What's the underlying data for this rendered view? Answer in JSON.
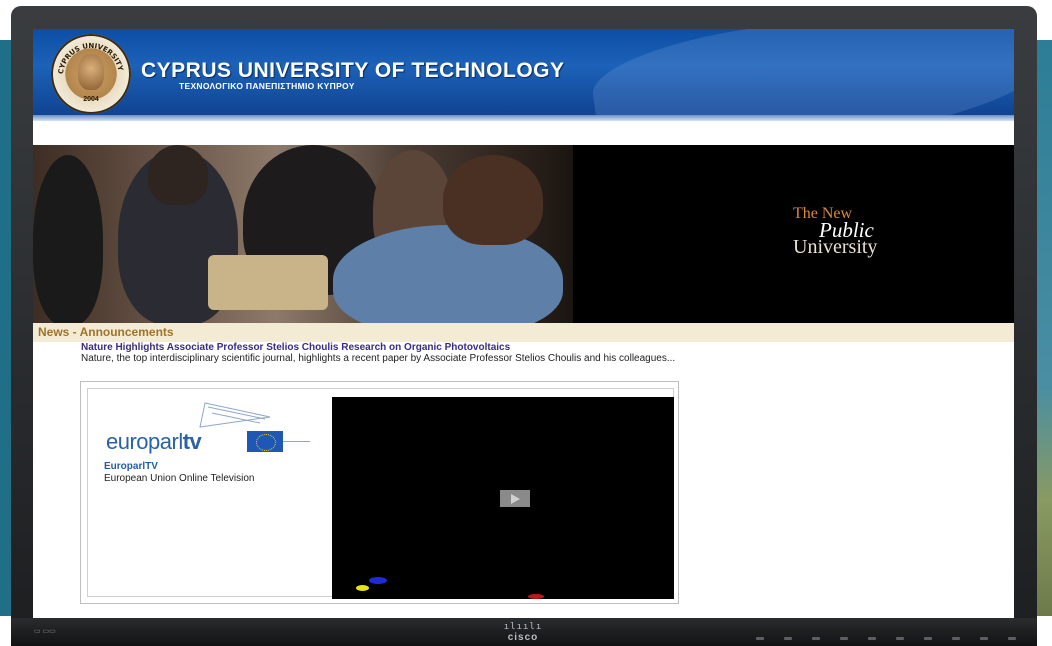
{
  "site": {
    "title": "CYPRUS UNIVERSITY OF TECHNOLOGY",
    "subtitle": "ΤΕΧΝΟΛΟΓΙΚΟ ΠΑΝΕΠΙΣΤΗΜΙΟ ΚΥΠΡΟΥ",
    "seal_year": "2004",
    "seal_text": "CYPRUS UNIVERSITY OF TECHNOLOGY"
  },
  "banner": {
    "tagline_line1": "The New",
    "tagline_line2": "Public",
    "tagline_line3": "University"
  },
  "news": {
    "section_title": "News - Announcements",
    "headline": "Nature Highlights Associate Professor Stelios Choulis Research on Organic Photovoltaics",
    "summary": "Nature, the top interdisciplinary scientific journal, highlights a recent paper by Associate Professor Stelios Choulis and his colleagues..."
  },
  "europarl": {
    "logo_text_light": "europarl",
    "logo_text_bold": "tv",
    "name": "EuroparlTV",
    "description": "European Union Online Television"
  },
  "monitor": {
    "brand": "cisco"
  },
  "colors": {
    "header_blue": "#0d4ea5",
    "news_bar": "#f4ebd5",
    "headline_purple": "#3a2b86",
    "europarl_blue": "#2a62a8"
  }
}
